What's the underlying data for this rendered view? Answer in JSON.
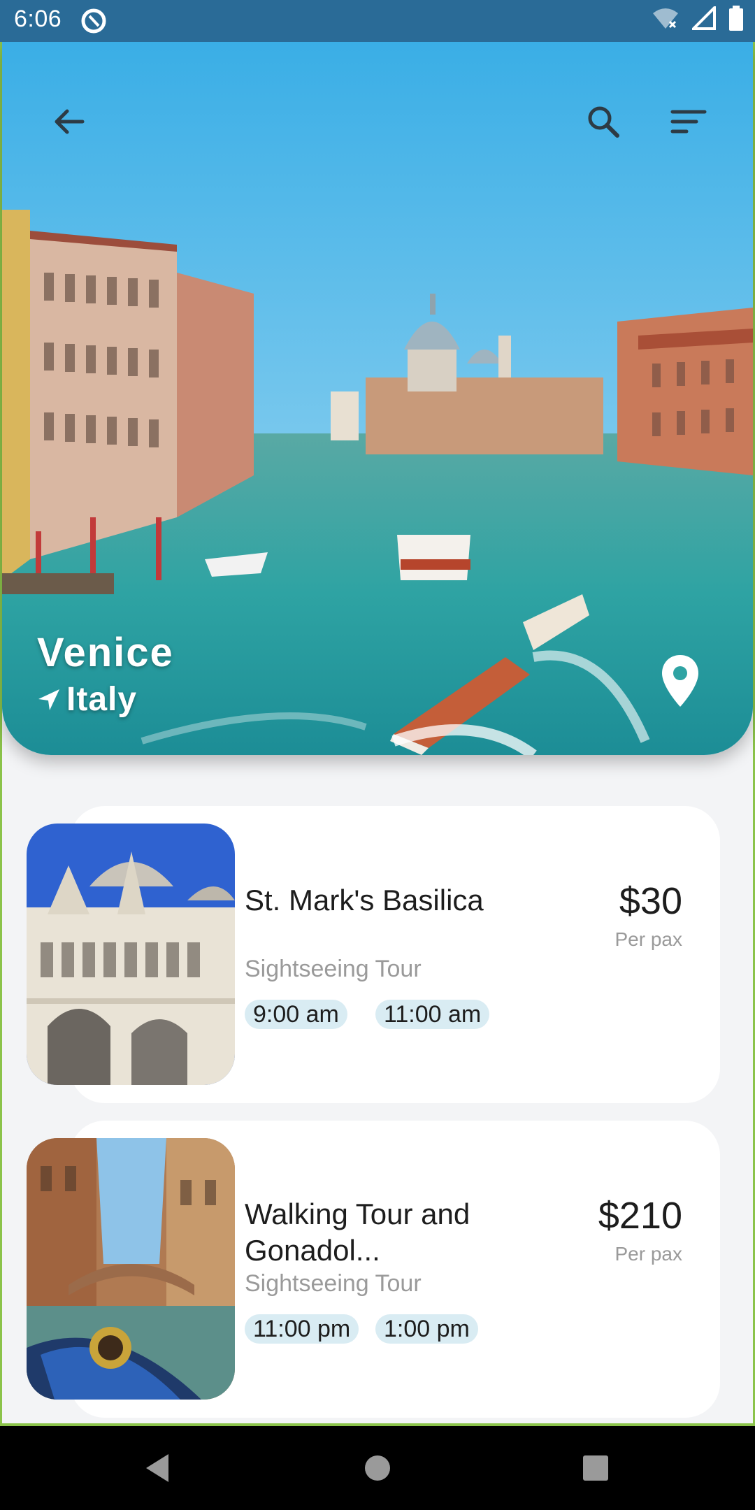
{
  "status_bar": {
    "time": "6:06",
    "icons": [
      "sync-icon",
      "wifi-icon",
      "signal-icon",
      "battery-icon"
    ]
  },
  "toolbar": {
    "icons": [
      "back-arrow-icon",
      "search-icon",
      "filter-icon"
    ]
  },
  "destination": {
    "city": "Venice",
    "country": "Italy",
    "icons": [
      "navigation-arrow-icon",
      "map-pin-icon"
    ]
  },
  "tours": [
    {
      "title": "St. Mark's Basilica",
      "category": "Sightseeing Tour",
      "times": [
        "9:00 am",
        "11:00 am"
      ],
      "price": "$30",
      "price_unit": "Per pax"
    },
    {
      "title": "Walking Tour and Gonadol...",
      "category": "Sightseeing Tour",
      "times": [
        "11:00 pm",
        "1:00 pm"
      ],
      "price": "$210",
      "price_unit": "Per pax"
    }
  ],
  "nav_bar": {
    "icons": [
      "back-triangle-icon",
      "home-circle-icon",
      "recents-square-icon"
    ]
  },
  "colors": {
    "status_bar": "#2a6b97",
    "chip": "#d9ecf3",
    "card": "#ffffff",
    "background": "#f3f4f6"
  }
}
